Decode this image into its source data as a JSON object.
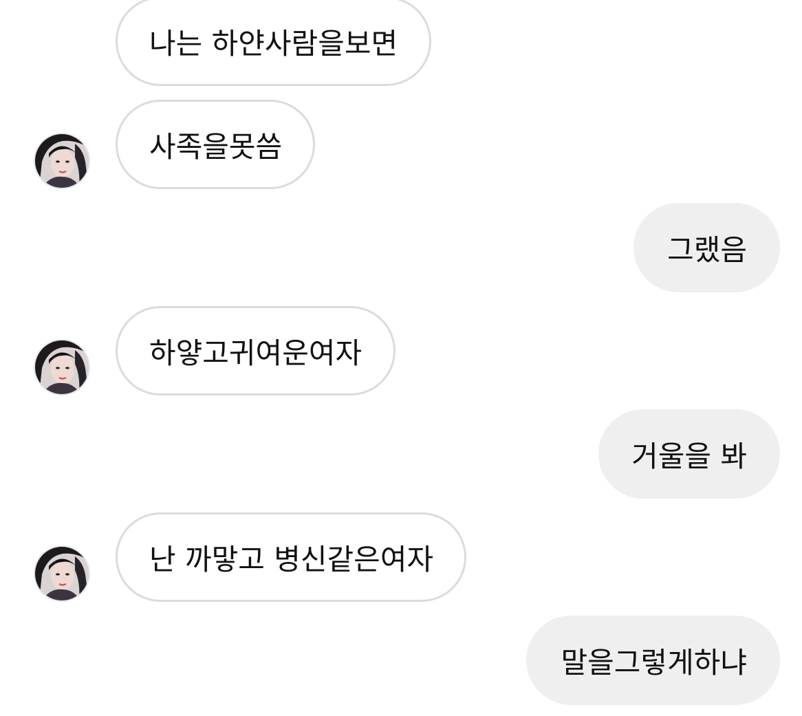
{
  "messages": [
    {
      "side": "received",
      "text": "나는 하얀사람을보면",
      "avatar": false
    },
    {
      "side": "received",
      "text": "사족을못씀",
      "avatar": true
    },
    {
      "side": "sent",
      "text": "그랬음"
    },
    {
      "side": "received",
      "text": "하얗고귀여운여자",
      "avatar": true
    },
    {
      "side": "sent",
      "text": "거울을 봐"
    },
    {
      "side": "received",
      "text": "난 까맣고 병신같은여자",
      "avatar": true
    },
    {
      "side": "sent",
      "text": "말을그렇게하냐"
    }
  ],
  "colors": {
    "background": "#ffffff",
    "received_bubble_border": "#dbdbdb",
    "sent_bubble_fill": "#efefef",
    "text": "#111111"
  },
  "icons": {
    "avatar": "profile-photo-icon"
  }
}
